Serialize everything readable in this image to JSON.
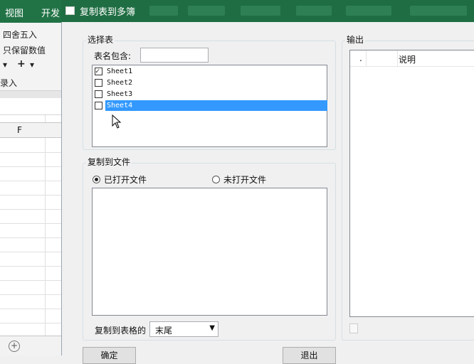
{
  "excel": {
    "tabs": [
      "视图",
      "开发"
    ],
    "ribbon_items": [
      "四舍五入",
      "只保留数值",
      "+",
      "录入"
    ],
    "column_letter": "F"
  },
  "dialog": {
    "title": "复制表到多簿",
    "select_group": {
      "label": "选择表",
      "name_filter_label": "表名包含:",
      "name_filter_value": "",
      "sheets": [
        {
          "name": "Sheet1",
          "checked": true
        },
        {
          "name": "Sheet2",
          "checked": false
        },
        {
          "name": "Sheet3",
          "checked": false
        },
        {
          "name": "Sheet4",
          "checked": false,
          "selected": true
        }
      ]
    },
    "copy_group": {
      "label": "复制到文件",
      "radio_open": "已打开文件",
      "radio_closed": "未打开文件",
      "position_label": "复制到表格的",
      "position_value": "末尾"
    },
    "output_group": {
      "label": "输出",
      "col_index": ".",
      "col_desc": "说明"
    },
    "ok_button": "确定",
    "exit_button": "退出"
  }
}
